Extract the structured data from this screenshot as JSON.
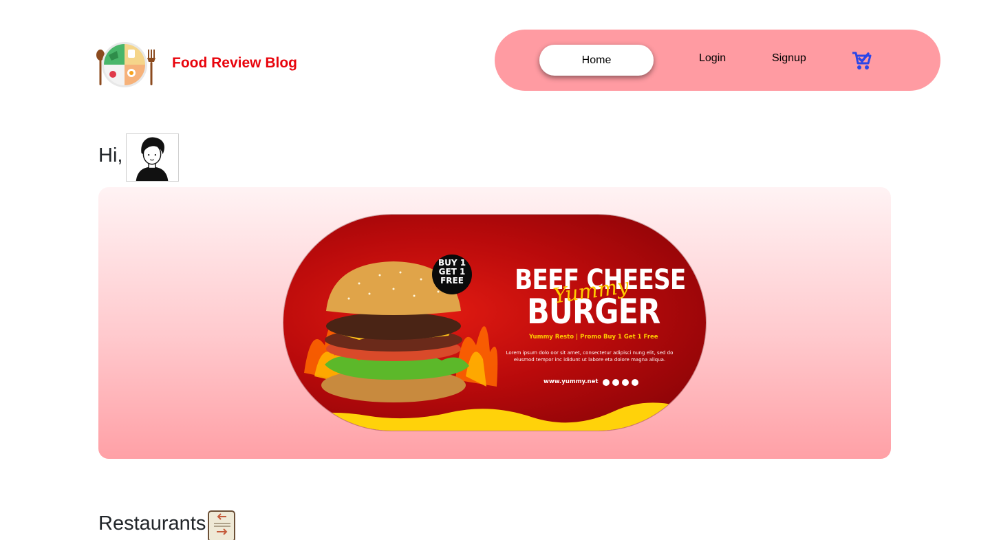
{
  "brand": {
    "title": "Food Review Blog",
    "logo_icon": "food-plate-logo-icon",
    "accent": "#e8040c"
  },
  "nav": {
    "background": "#ff9ba2",
    "items": [
      {
        "label": "Home",
        "active": true
      },
      {
        "label": "Login",
        "active": false
      },
      {
        "label": "Signup",
        "active": false
      }
    ],
    "cart_icon": "shopping-cart-check-icon"
  },
  "greeting": {
    "text": "Hi,",
    "avatar_icon": "user-avatar-icon"
  },
  "hero": {
    "banner": {
      "badge": [
        "BUY 1",
        "GET 1",
        "FREE"
      ],
      "title_line1": "BEEF CHEESE",
      "script_word": "Yummy",
      "title_line2": "BURGER",
      "promo": "Yummy Resto | Promo Buy 1 Get 1 Free",
      "body": "Lorem ipsum dolo oor sit amet, consectetur adipisci nung elit, sed do eiusmod tempor inc ididunt ut labore eta dolore magna aliqua.",
      "website": "www.yummy.net",
      "brand_label": "Yummy"
    }
  },
  "restaurants": {
    "title": "Restaurants",
    "icon": "restaurant-menu-icon"
  }
}
